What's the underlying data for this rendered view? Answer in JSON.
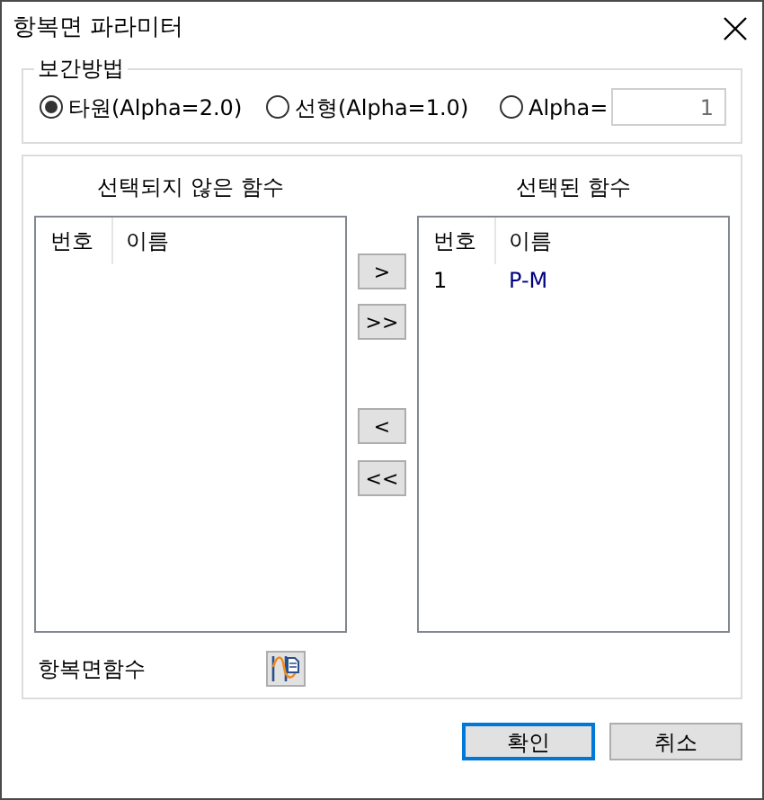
{
  "window": {
    "title": "항복면 파라미터"
  },
  "interpolation": {
    "legend": "보간방법",
    "options": [
      {
        "label": "타원(Alpha=2.0)",
        "selected": true
      },
      {
        "label": "선형(Alpha=1.0)",
        "selected": false
      },
      {
        "label": "Alpha=",
        "selected": false
      }
    ],
    "alpha_value": "1",
    "alpha_disabled": true
  },
  "unselected_functions": {
    "title": "선택되지 않은 함수",
    "columns": [
      "번호",
      "이름"
    ]
  },
  "selected_functions": {
    "title": "선택된 함수",
    "columns": [
      "번호",
      "이름"
    ],
    "rows": [
      [
        "1",
        "P-M"
      ]
    ]
  },
  "move_buttons": [
    ">",
    ">>",
    "<",
    "<<"
  ],
  "yield_function": {
    "label": "항복면함수"
  },
  "buttons": [
    {
      "label": "확인",
      "default": true
    },
    {
      "label": "취소",
      "default": false
    }
  ]
}
